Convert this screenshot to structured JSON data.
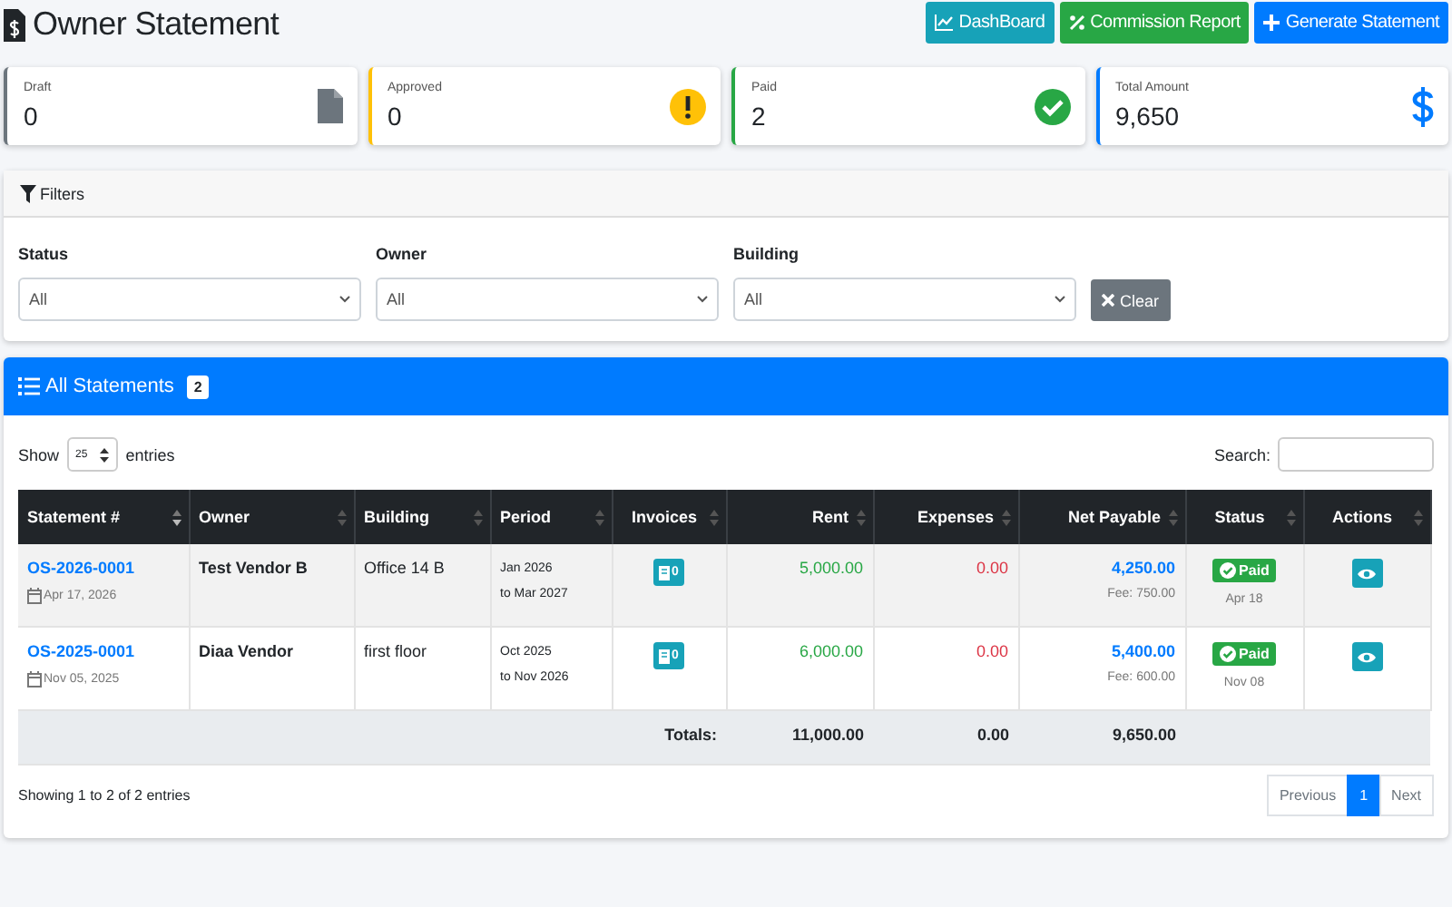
{
  "header": {
    "title": "Owner Statement",
    "buttons": [
      {
        "label": "DashBoard",
        "kind": "info"
      },
      {
        "label": "Commission Report",
        "kind": "success"
      },
      {
        "label": "Generate Statement",
        "kind": "primary"
      }
    ]
  },
  "stats": [
    {
      "label": "Draft",
      "value": "0",
      "kind": "draft"
    },
    {
      "label": "Approved",
      "value": "0",
      "kind": "approved"
    },
    {
      "label": "Paid",
      "value": "2",
      "kind": "paid"
    },
    {
      "label": "Total Amount",
      "value": "9,650",
      "kind": "total"
    }
  ],
  "filters": {
    "title": "Filters",
    "fields": [
      {
        "label": "Status",
        "value": "All"
      },
      {
        "label": "Owner",
        "value": "All"
      },
      {
        "label": "Building",
        "value": "All"
      }
    ],
    "clear_button": "Clear"
  },
  "statements": {
    "title": "All Statements",
    "count": "2",
    "show_label": "Show",
    "page_length": "25",
    "entries_label": "entries",
    "search_label": "Search:",
    "columns": [
      {
        "label": "Statement #",
        "sorted": true
      },
      {
        "label": "Owner",
        "sorted": false
      },
      {
        "label": "Building",
        "sorted": false
      },
      {
        "label": "Period",
        "sorted": false
      },
      {
        "label": "Invoices",
        "sorted": false
      },
      {
        "label": "Rent",
        "sorted": false
      },
      {
        "label": "Expenses",
        "sorted": false
      },
      {
        "label": "Net Payable",
        "sorted": false
      },
      {
        "label": "Status",
        "sorted": false
      },
      {
        "label": "Actions",
        "sorted": false
      }
    ],
    "rows": [
      {
        "number": "OS-2026-0001",
        "date": "Apr 17, 2026",
        "owner": "Test Vendor B",
        "building": "Office 14 B",
        "period_from": "Jan 2026",
        "period_to": "to Mar 2027",
        "invoices": "0",
        "rent": "5,000.00",
        "expenses": "0.00",
        "net_payable": "4,250.00",
        "fee": "Fee: 750.00",
        "status": "Paid",
        "status_date": "Apr 18"
      },
      {
        "number": "OS-2025-0001",
        "date": "Nov 05, 2025",
        "owner": "Diaa Vendor",
        "building": "first floor",
        "period_from": "Oct 2025",
        "period_to": "to Nov 2026",
        "invoices": "0",
        "rent": "6,000.00",
        "expenses": "0.00",
        "net_payable": "5,400.00",
        "fee": "Fee: 600.00",
        "status": "Paid",
        "status_date": "Nov 08"
      }
    ],
    "totals": {
      "label": "Totals:",
      "rent": "11,000.00",
      "expenses": "0.00",
      "net_payable": "9,650.00"
    },
    "info": "Showing 1 to 2 of 2 entries",
    "pagination": [
      {
        "label": "Previous",
        "selected": false
      },
      {
        "label": "1",
        "selected": true
      },
      {
        "label": "Next",
        "selected": false
      }
    ]
  }
}
